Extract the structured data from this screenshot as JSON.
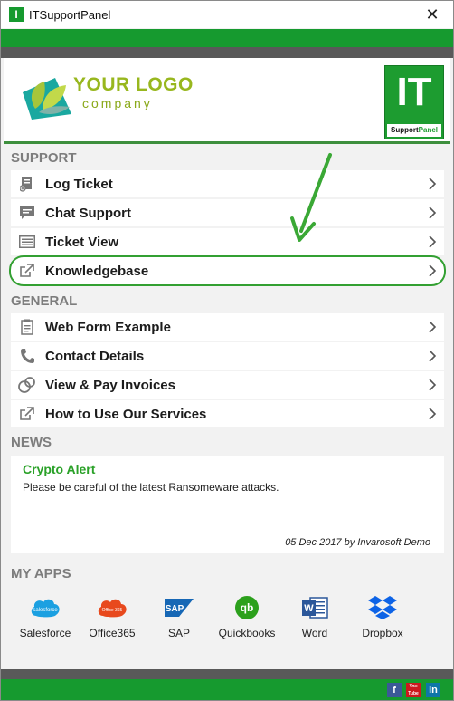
{
  "window": {
    "title": "ITSupportPanel",
    "close_glyph": "✕"
  },
  "header": {
    "logo_line1": "YOUR LOGO",
    "logo_line2": "company",
    "badge_big": "IT",
    "badge_small_1": "Support",
    "badge_small_2": "Panel"
  },
  "support": {
    "title": "SUPPORT",
    "items": [
      {
        "label": "Log Ticket",
        "icon": "ticket-icon"
      },
      {
        "label": "Chat Support",
        "icon": "chat-icon"
      },
      {
        "label": "Ticket View",
        "icon": "list-icon"
      },
      {
        "label": "Knowledgebase",
        "icon": "external-link-icon",
        "highlighted": true
      }
    ]
  },
  "general": {
    "title": "GENERAL",
    "items": [
      {
        "label": "Web Form Example",
        "icon": "clipboard-icon"
      },
      {
        "label": "Contact Details",
        "icon": "phone-icon"
      },
      {
        "label": "View & Pay Invoices",
        "icon": "coins-icon"
      },
      {
        "label": "How to Use Our Services",
        "icon": "external-link-icon"
      }
    ]
  },
  "news": {
    "title": "NEWS",
    "headline": "Crypto Alert",
    "body": "Please be careful of the latest Ransomeware attacks.",
    "meta": "05 Dec 2017 by Invarosoft Demo"
  },
  "apps": {
    "title": "MY APPS",
    "items": [
      {
        "label": "Salesforce",
        "icon": "salesforce-icon",
        "icon_text": "salesforce"
      },
      {
        "label": "Office365",
        "icon": "office365-icon",
        "icon_text": "Office 365"
      },
      {
        "label": "SAP",
        "icon": "sap-icon",
        "icon_text": "SAP"
      },
      {
        "label": "Quickbooks",
        "icon": "quickbooks-icon",
        "icon_text": "qb"
      },
      {
        "label": "Word",
        "icon": "word-icon",
        "icon_text": "W"
      },
      {
        "label": "Dropbox",
        "icon": "dropbox-icon",
        "icon_text": ""
      }
    ]
  },
  "footer": {
    "social": [
      {
        "name": "facebook-icon",
        "glyph": "f"
      },
      {
        "name": "youtube-icon",
        "glyph": "You Tube"
      },
      {
        "name": "linkedin-icon",
        "glyph": "in"
      }
    ]
  },
  "colors": {
    "brand_green": "#169a2f",
    "band_gray": "#595959",
    "highlight_green": "#33a032"
  }
}
